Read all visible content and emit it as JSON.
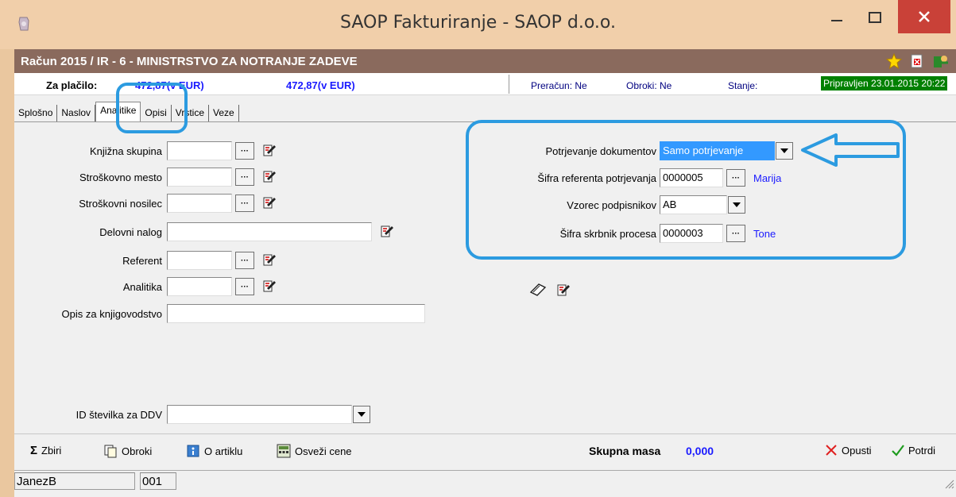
{
  "window": {
    "title": "SAOP Fakturiranje - SAOP d.o.o.",
    "controls": {
      "minimize": "—",
      "maximize": "☐",
      "close": "✕"
    }
  },
  "document": {
    "title": "Račun  2015 / IR - 6 - MINISTRSTVO ZA NOTRANJE ZADEVE"
  },
  "summary": {
    "label": "Za plačilo:",
    "amount_1": "472,87(v EUR)",
    "amount_2": "472,87(v EUR)",
    "preracun": "Preračun: Ne",
    "obroki": "Obroki: Ne",
    "stanje_label": "Stanje:",
    "stanje_value": "Pripravljen 23.01.2015 20:22"
  },
  "tabs": [
    "Splošno",
    "Naslov",
    "Analitike",
    "Opisi",
    "Vrstice",
    "Veze"
  ],
  "left_form": {
    "knjizna_skupina": {
      "label": "Knjižna skupina",
      "value": ""
    },
    "strooskovno_mesto": {
      "label": "Stroškovno mesto",
      "value": ""
    },
    "stroskovni_nosilec": {
      "label": "Stroškovni  nosilec",
      "value": ""
    },
    "delovni_nalog": {
      "label": "Delovni nalog",
      "value": ""
    },
    "referent": {
      "label": "Referent",
      "value": ""
    },
    "analitika": {
      "label": "Analitika",
      "value": ""
    },
    "opis_knjigovodstvo": {
      "label": "Opis za knjigovodstvo",
      "value": ""
    },
    "id_ddv": {
      "label": "ID številka za DDV",
      "value": ""
    }
  },
  "right_form": {
    "potrjevanje": {
      "label": "Potrjevanje dokumentov",
      "value": "Samo potrjevanje"
    },
    "sifra_referenta": {
      "label": "Šifra referenta potrjevanja",
      "value": "0000005",
      "name": "Marija"
    },
    "vzorec": {
      "label": "Vzorec podpisnikov",
      "value": "AB"
    },
    "sifra_skrbnik": {
      "label": "Šifra skrbnik procesa",
      "value": "0000003",
      "name": "Tone"
    }
  },
  "bottom": {
    "zbiri": "Zbiri",
    "obroki": "Obroki",
    "o_artiklu": "O artiklu",
    "osvezi_cene": "Osveži cene",
    "masa_label": "Skupna masa",
    "masa_value": "0,000",
    "opusti": "Opusti",
    "potrdi": "Potrdi"
  },
  "status": {
    "user": "JanezB",
    "code": "001"
  },
  "colors": {
    "accent": "#2c9be0",
    "link": "#1a1aff",
    "header": "#8a6a5d",
    "close": "#c94138"
  }
}
